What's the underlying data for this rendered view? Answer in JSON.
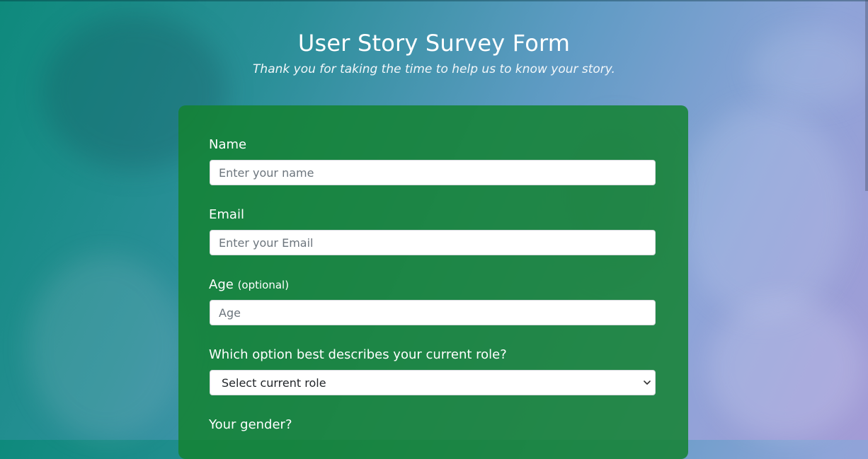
{
  "header": {
    "title": "User Story Survey Form",
    "description": "Thank you for taking the time to help us to know your story."
  },
  "form": {
    "name": {
      "label": "Name",
      "placeholder": "Enter your name"
    },
    "email": {
      "label": "Email",
      "placeholder": "Enter your Email"
    },
    "age": {
      "label": "Age",
      "optional": "(optional)",
      "placeholder": "Age"
    },
    "role": {
      "label": "Which option best describes your current role?",
      "selected": "Select current role"
    },
    "gender": {
      "label": "Your gender?"
    }
  },
  "icons": {
    "dropdown": "chevron-down-icon"
  },
  "colors": {
    "card": "#1e8a3e",
    "title": "#ffffff",
    "input_bg": "#ffffff"
  }
}
